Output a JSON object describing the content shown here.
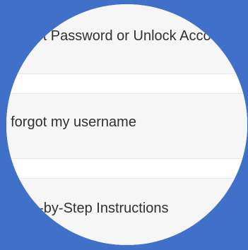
{
  "options": [
    {
      "label": "Reset Password or Unlock Account"
    },
    {
      "label": "I forgot my username"
    },
    {
      "label": "Step-by-Step Instructions"
    }
  ],
  "colors": {
    "background": "#4070c8",
    "row_background": "#f6f6f6",
    "text": "#303030"
  }
}
